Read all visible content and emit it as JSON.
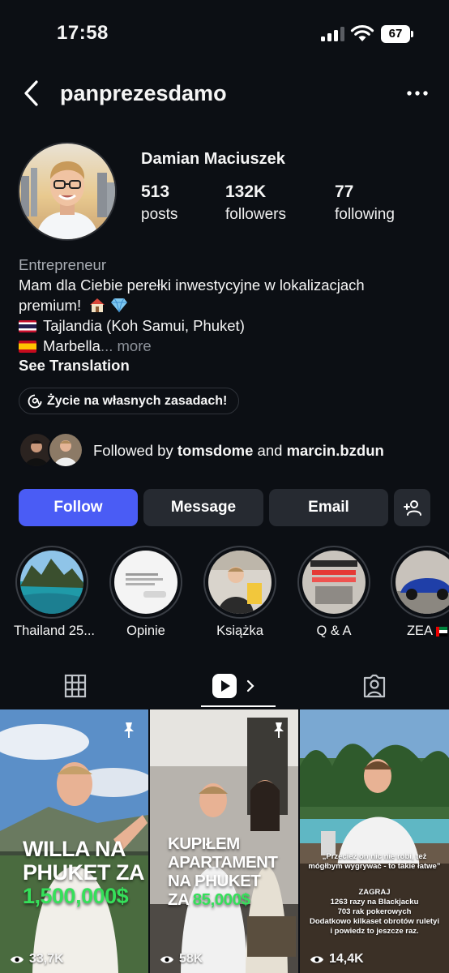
{
  "status_bar": {
    "time": "17:58",
    "battery": "67"
  },
  "header": {
    "username": "panprezesdamo"
  },
  "profile": {
    "display_name": "Damian Maciuszek",
    "stats": [
      {
        "value": "513",
        "label": "posts"
      },
      {
        "value": "132K",
        "label": "followers"
      },
      {
        "value": "77",
        "label": "following"
      }
    ],
    "category": "Entrepreneur",
    "bio_line1": "Mam dla Ciebie perełki inwestycyjne w lokalizacjach",
    "bio_line2": "premium!",
    "bio_line3": "Tajlandia (Koh Samui, Phuket)",
    "bio_line4": "Marbella",
    "bio_more": "... more",
    "see_translation": "See Translation",
    "threads_badge": "Życie na własnych zasadach!",
    "followed_by_prefix": "Followed by ",
    "followed_by_user1": "tomsdome",
    "followed_by_and": " and ",
    "followed_by_user2": "marcin.bzdun"
  },
  "actions": {
    "follow": "Follow",
    "message": "Message",
    "email": "Email"
  },
  "highlights": [
    {
      "label": "Thailand 25..."
    },
    {
      "label": "Opinie"
    },
    {
      "label": "Książka"
    },
    {
      "label": "Q & A"
    },
    {
      "label": "ZEA"
    }
  ],
  "reels": [
    {
      "line1": "WILLA NA",
      "line2": "PHUKET ZA",
      "price": "1,500,000$",
      "views": "33,7K",
      "pinned": true
    },
    {
      "line1": "KUPIŁEM",
      "line2": "APARTAMENT",
      "line3": "NA PHUKET",
      "line4_prefix": "ZA ",
      "price": "85,000$",
      "views": "58K",
      "pinned": true
    },
    {
      "quote": "„Przecież on nic nie robi, też mógłbym wygrywać - to takie łatwe”",
      "caption_title": "ZAGRAJ",
      "caption_line1": "1263 razy na Blackjacku",
      "caption_line2": "703 rak pokerowych",
      "caption_line3": "Dodatkowo kilkaset obrotów ruletyi",
      "caption_line4": "i powiedz to jeszcze raz.",
      "views": "14,4K",
      "pinned": false
    }
  ],
  "colors": {
    "background": "#0c0f14",
    "accent": "#4a5cf5",
    "button": "#262a31",
    "price_green": "#35e05a"
  }
}
